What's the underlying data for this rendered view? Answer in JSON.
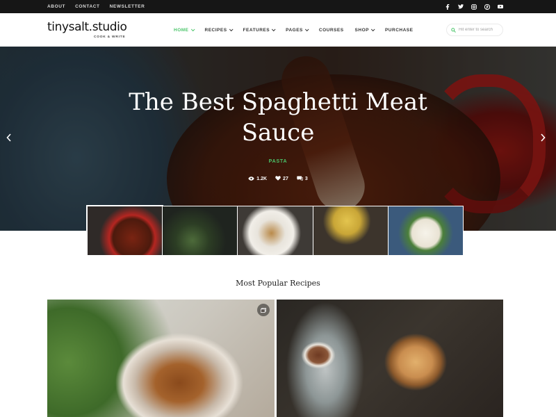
{
  "topbar": {
    "links": [
      "ABOUT",
      "CONTACT",
      "NEWSLETTER"
    ],
    "social_icons": [
      "facebook-icon",
      "twitter-icon",
      "instagram-icon",
      "pinterest-icon",
      "youtube-icon"
    ]
  },
  "header": {
    "logo": "tinysalt.studio",
    "tagline": "COOK & WRITE",
    "nav": [
      {
        "label": "HOME",
        "dropdown": true,
        "active": true
      },
      {
        "label": "RECIPES",
        "dropdown": true
      },
      {
        "label": "FEATURES",
        "dropdown": true
      },
      {
        "label": "PAGES",
        "dropdown": true
      },
      {
        "label": "COURSES",
        "dropdown": false
      },
      {
        "label": "SHOP",
        "dropdown": true
      },
      {
        "label": "PURCHASE",
        "dropdown": false
      }
    ],
    "search_placeholder": "Hit enter to search"
  },
  "hero": {
    "title": "The Best Spaghetti Meat Sauce",
    "category": "PASTA",
    "views": "1.2K",
    "likes": "27",
    "comments": "3"
  },
  "popular": {
    "title": "Most Popular Recipes"
  },
  "colors": {
    "accent": "#4ac56a",
    "topbar_bg": "#161616"
  }
}
